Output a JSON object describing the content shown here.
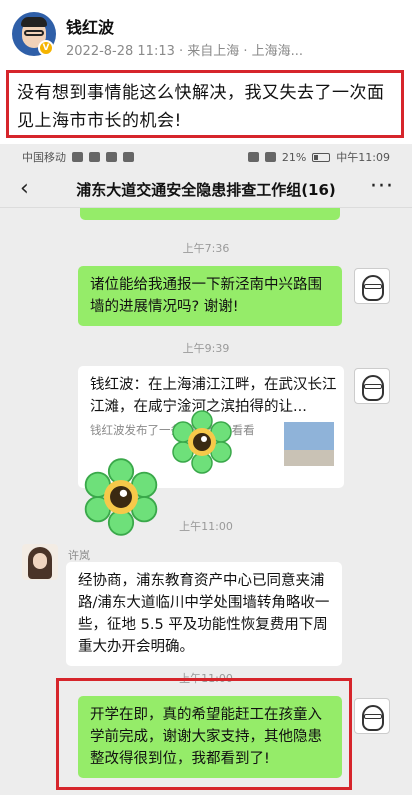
{
  "post": {
    "author": "钱红波",
    "verified_badge": "V",
    "meta": "2022-8-28 11:13 · 来自上海 · 上海海...",
    "text": "没有想到事情能这么快解决，我又失去了一次面见上海市市长的机会!"
  },
  "status_bar": {
    "carrier": "中国移动",
    "battery": "21%",
    "time": "中午11:09"
  },
  "chat": {
    "title": "浦东大道交通安全隐患排查工作组(16)",
    "back_icon": "back-arrow-icon",
    "more_icon": "more-dots-icon",
    "messages": [
      {
        "time": "上午7:36"
      },
      {
        "from": "me",
        "text": "诸位能给我通报一下新泾南中兴路围墙的进展情况吗? 谢谢!"
      },
      {
        "time": "上午9:39"
      },
      {
        "from": "me",
        "type": "link",
        "title": "钱红波：在上海浦江江畔，在武汉长江江滩，在咸宁淦河之滨拍得的让...",
        "desc": "钱红波发布了一条       邀请你来看看"
      },
      {
        "time": "上午11:00"
      },
      {
        "from": "许岚",
        "text": "经协商，浦东教育资产中心已同意夹浦路/浦东大道临川中学处围墙转角略收一些，征地 5.5 平及功能性恢复费用下周重大办开会明确。"
      },
      {
        "time": "上午11:00"
      },
      {
        "from": "me",
        "text": "开学在即，真的希望能赶工在孩童入学前完成，谢谢大家支持，其他隐患整改得很到位，我都看到了!"
      }
    ]
  },
  "colors": {
    "highlight_red": "#d6252b",
    "my_bubble": "#95ec69",
    "chat_bg": "#ededed",
    "flower_petal": "#6ee07a"
  }
}
